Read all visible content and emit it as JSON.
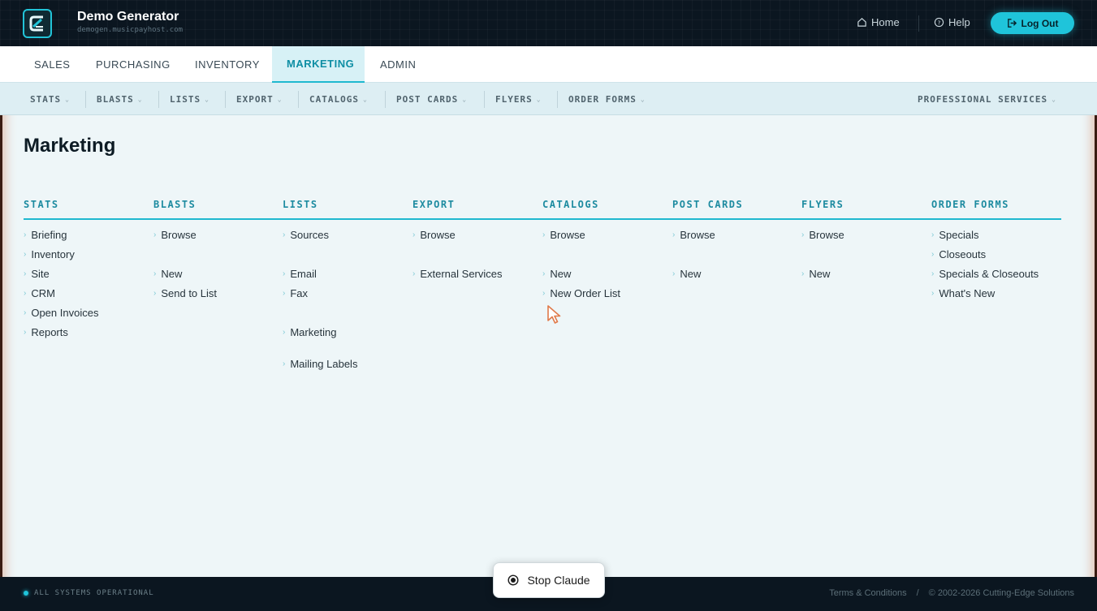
{
  "app": {
    "title": "Demo Generator",
    "subtitle": "demogen.musicpayhost.com",
    "home_label": "Home",
    "help_label": "Help",
    "logout_label": "Log Out"
  },
  "mainnav": {
    "tabs": [
      "SALES",
      "PURCHASING",
      "INVENTORY",
      "MARKETING",
      "ADMIN"
    ],
    "active": "MARKETING"
  },
  "subnav": {
    "items": [
      "STATS",
      "BLASTS",
      "LISTS",
      "EXPORT",
      "CATALOGS",
      "POST CARDS",
      "FLYERS",
      "ORDER FORMS"
    ],
    "right_item": "PROFESSIONAL SERVICES"
  },
  "page": {
    "title": "Marketing"
  },
  "columns": [
    {
      "heading": "STATS",
      "links": [
        "Briefing",
        "Inventory",
        "Site",
        "CRM",
        "Open Invoices",
        "Reports"
      ]
    },
    {
      "heading": "BLASTS",
      "links": [
        "Browse",
        "New",
        "Send to List"
      ]
    },
    {
      "heading": "LISTS",
      "links": [
        "Sources",
        "Email",
        "Fax",
        "Marketing",
        "Mailing Labels"
      ]
    },
    {
      "heading": "EXPORT",
      "links": [
        "Browse",
        "External Services"
      ]
    },
    {
      "heading": "CATALOGS",
      "links": [
        "Browse",
        "New",
        "New Order List"
      ]
    },
    {
      "heading": "POST CARDS",
      "links": [
        "Browse",
        "New"
      ]
    },
    {
      "heading": "FLYERS",
      "links": [
        "Browse",
        "New"
      ]
    },
    {
      "heading": "ORDER FORMS",
      "links": [
        "Specials",
        "Closeouts",
        "Specials & Closeouts",
        "What's New"
      ]
    }
  ],
  "footer": {
    "status": "ALL SYSTEMS OPERATIONAL",
    "terms": "Terms & Conditions",
    "separator": "/",
    "copyright": "© 2002-2026 Cutting-Edge Solutions"
  },
  "overlay": {
    "stop_label": "Stop Claude"
  },
  "colors": {
    "accent": "#1fc4da",
    "topbar_bg": "#0b1620",
    "content_bg": "#eef6f8",
    "heading": "#1d8ba0"
  },
  "icons": [
    "app-logo-icon",
    "home-icon",
    "help-icon",
    "logout-icon",
    "chevron-down-icon",
    "chevron-right-icon",
    "stop-record-icon",
    "cursor-icon"
  ]
}
